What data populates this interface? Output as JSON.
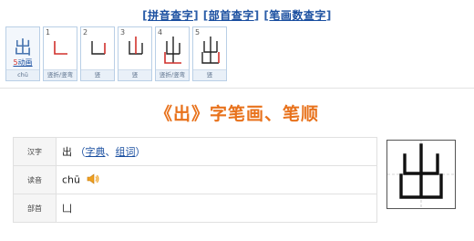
{
  "nav": {
    "pinyin": "拼音查字",
    "bushou": "部首查字",
    "bihua": "笔画数查字"
  },
  "strokes": {
    "main_char": "出",
    "stroke_count": "5",
    "anim_label": "动画",
    "main_pinyin": "chū",
    "items": [
      {
        "num": "1",
        "label": "竖折/竖弯"
      },
      {
        "num": "2",
        "label": "竖"
      },
      {
        "num": "3",
        "label": "竖"
      },
      {
        "num": "4",
        "label": "竖折/竖弯"
      },
      {
        "num": "5",
        "label": "竖"
      }
    ]
  },
  "heading": "《出》字笔画、笔顺",
  "info": {
    "row1_key": "汉字",
    "row1_char": "出",
    "row1_link1": "字典",
    "row1_sep": "、",
    "row1_link2": "组词",
    "row1_open": "（",
    "row1_close": "）",
    "row2_key": "读音",
    "row2_value": "chū",
    "row3_key": "部首",
    "row3_value": "凵"
  },
  "colors": {
    "heading": "#e8721c",
    "link": "#1a4fa0",
    "stroke_highlight": "#d0302c"
  },
  "icons": [
    "speaker-icon"
  ]
}
